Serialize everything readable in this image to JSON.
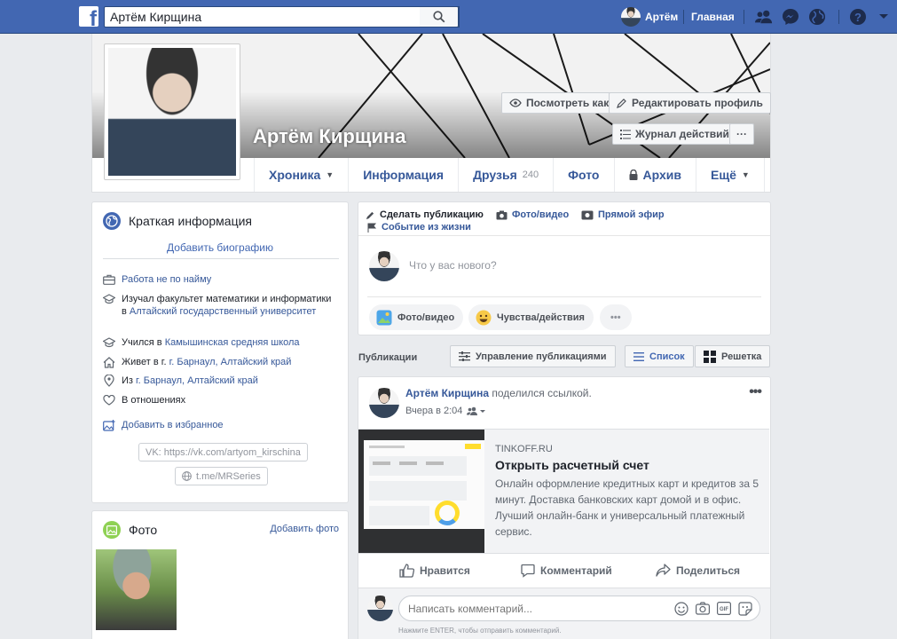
{
  "topbar": {
    "search_value": "Артём Кирщина",
    "user_name": "Артём",
    "home": "Главная"
  },
  "profile": {
    "name": "Артём Кирщина",
    "view_as": "Посмотреть как",
    "edit_profile": "Редактировать профиль",
    "activity_log": "Журнал действий",
    "more_dots": "···"
  },
  "tabs": [
    {
      "label": "Хроника",
      "caret": "▼"
    },
    {
      "label": "Информация"
    },
    {
      "label": "Друзья",
      "count": "240"
    },
    {
      "label": "Фото"
    },
    {
      "label": "Архив"
    },
    {
      "label": "Ещё",
      "caret": "▼"
    }
  ],
  "intro": {
    "title": "Краткая информация",
    "add_bio": "Добавить биографию",
    "work": "Работа не по найму",
    "study_prefix": "Изучал факультет математики и информатики в ",
    "study_link": "Алтайский государственный университет",
    "school_prefix": "Учился в ",
    "school_link": "Камышинская средняя школа",
    "lives_prefix": "Живет в г. ",
    "lives_link": "г. Барнаул, Алтайский край",
    "from_prefix": "Из ",
    "from_link": "г. Барнаул, Алтайский край",
    "relationship": "В отношениях",
    "add_featured": "Добавить в избранное",
    "vk": "VK: https://vk.com/artyom_kirschina",
    "telegram": "t.me/MRSeries"
  },
  "photos": {
    "title": "Фото",
    "add_photo": "Добавить фото"
  },
  "composer": {
    "make_post": "Сделать публикацию",
    "photo_video": "Фото/видео",
    "live": "Прямой эфир",
    "life_event": "Событие из жизни",
    "placeholder": "Что у вас нового?",
    "btn_photo": "Фото/видео",
    "btn_feeling": "Чувства/действия",
    "btn_more": "•••"
  },
  "publications": {
    "label": "Публикации",
    "manage": "Управление публикациями",
    "list": "Список",
    "grid": "Решетка"
  },
  "post": {
    "author": "Артём Кирщина",
    "action": " поделился ссылкой.",
    "time": "Вчера в 2:04",
    "menu": "•••",
    "link_domain": "TINKOFF.RU",
    "link_title": "Открыть расчетный счет",
    "link_desc": "Онлайн оформление кредитных карт и кредитов за 5 минут. Доставка банковских карт домой и в офис. Лучший онлайн-банк и универсальный платежный сервис.",
    "like": "Нравится",
    "comment": "Комментарий",
    "share": "Поделиться",
    "comment_placeholder": "Написать комментарий...",
    "hint": "Нажмите ENTER, чтобы отправить комментарий."
  },
  "colors": {
    "brand": "#4267b2",
    "link": "#365899",
    "bg": "#e9ebee"
  }
}
